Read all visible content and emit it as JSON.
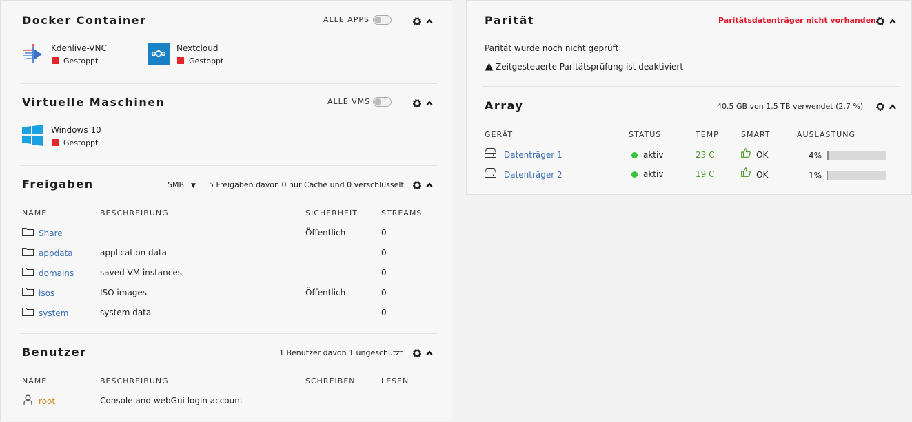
{
  "docker": {
    "title": "Docker Container",
    "toggle_label": "ALLE APPS",
    "apps": [
      {
        "name": "Kdenlive-VNC",
        "status": "Gestoppt",
        "icon": "kdenlive-icon"
      },
      {
        "name": "Nextcloud",
        "status": "Gestoppt",
        "icon": "nextcloud-icon"
      }
    ]
  },
  "vms": {
    "title": "Virtuelle Maschinen",
    "toggle_label": "ALLE VMS",
    "items": [
      {
        "name": "Windows 10",
        "status": "Gestoppt",
        "icon": "windows-icon"
      }
    ]
  },
  "shares": {
    "title": "Freigaben",
    "protocol": "SMB",
    "summary": "5 Freigaben davon 0 nur Cache und 0 verschlüsselt",
    "columns": [
      "NAME",
      "BESCHREIBUNG",
      "SICHERHEIT",
      "STREAMS"
    ],
    "rows": [
      {
        "name": "Share",
        "desc": "",
        "security": "Öffentlich",
        "streams": "0"
      },
      {
        "name": "appdata",
        "desc": "application data",
        "security": "-",
        "streams": "0"
      },
      {
        "name": "domains",
        "desc": "saved VM instances",
        "security": "-",
        "streams": "0"
      },
      {
        "name": "isos",
        "desc": "ISO images",
        "security": "Öffentlich",
        "streams": "0"
      },
      {
        "name": "system",
        "desc": "system data",
        "security": "-",
        "streams": "0"
      }
    ]
  },
  "users": {
    "title": "Benutzer",
    "summary": "1 Benutzer davon 1 ungeschützt",
    "columns": [
      "NAME",
      "BESCHREIBUNG",
      "SCHREIBEN",
      "LESEN"
    ],
    "rows": [
      {
        "name": "root",
        "desc": "Console and webGui login account",
        "write": "-",
        "read": "-"
      }
    ]
  },
  "parity": {
    "title": "Parität",
    "warning": "Paritätsdatenträger nicht vorhanden",
    "line1": "Parität wurde noch nicht geprüft",
    "line2": "Zeitgesteuerte Paritätsprüfung ist deaktiviert"
  },
  "array": {
    "title": "Array",
    "usage": "40.5 GB von 1.5 TB verwendet (2.7 %)",
    "columns": [
      "GERÄT",
      "STATUS",
      "TEMP",
      "SMART",
      "AUSLASTUNG"
    ],
    "rows": [
      {
        "name": "Datenträger 1",
        "status": "aktiv",
        "temp": "23 C",
        "smart": "OK",
        "usage_label": "4%",
        "usage_pct": 4
      },
      {
        "name": "Datenträger 2",
        "status": "aktiv",
        "temp": "19 C",
        "smart": "OK",
        "usage_label": "1%",
        "usage_pct": 1
      }
    ]
  },
  "colors": {
    "link": "#3a6fb6",
    "stopped": "#e22828",
    "active": "#3ac43a",
    "warning": "#e0182d",
    "temp": "#4b9a2a",
    "user": "#d98b1f"
  }
}
